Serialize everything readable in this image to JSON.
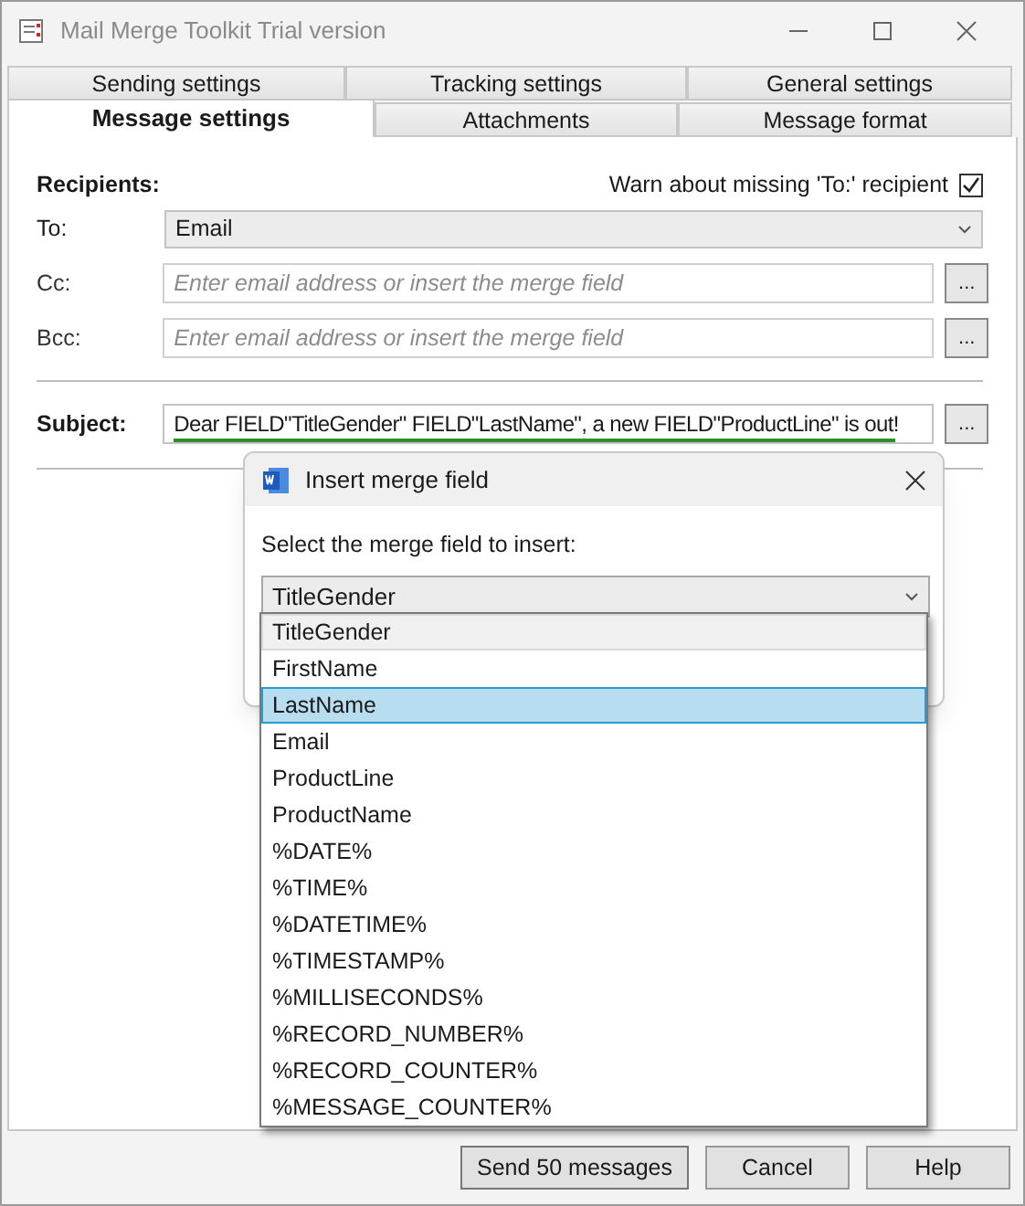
{
  "window": {
    "title": "Mail Merge Toolkit Trial version"
  },
  "tabs": [
    [
      {
        "label": "Sending settings",
        "selected": false
      },
      {
        "label": "Tracking settings",
        "selected": false
      },
      {
        "label": "General settings",
        "selected": false
      }
    ],
    [
      {
        "label": "Message settings",
        "selected": true
      },
      {
        "label": "Attachments",
        "selected": false
      },
      {
        "label": "Message format",
        "selected": false
      }
    ]
  ],
  "recipients": {
    "label": "Recipients:",
    "warn_label": "Warn about missing 'To:' recipient",
    "warn_checked": true,
    "to": {
      "label": "To:",
      "value": "Email"
    },
    "cc": {
      "label": "Cc:",
      "placeholder": "Enter email address or insert the merge field",
      "button": "..."
    },
    "bcc": {
      "label": "Bcc:",
      "placeholder": "Enter email address or insert the merge field",
      "button": "..."
    }
  },
  "subject": {
    "label": "Subject:",
    "value": "Dear FIELD\"TitleGender\" FIELD\"LastName\", a new FIELD\"ProductLine\" is out!",
    "underlined": true,
    "button": "..."
  },
  "dialog": {
    "title": "Insert merge field",
    "prompt": "Select the merge field to insert:",
    "value": "TitleGender",
    "options": [
      {
        "label": "TitleGender",
        "selected": true,
        "highlighted": false
      },
      {
        "label": "FirstName",
        "selected": false,
        "highlighted": false
      },
      {
        "label": "LastName",
        "selected": false,
        "highlighted": true
      },
      {
        "label": "Email",
        "selected": false,
        "highlighted": false
      },
      {
        "label": "ProductLine",
        "selected": false,
        "highlighted": false
      },
      {
        "label": "ProductName",
        "selected": false,
        "highlighted": false
      },
      {
        "label": "%DATE%",
        "selected": false,
        "highlighted": false
      },
      {
        "label": "%TIME%",
        "selected": false,
        "highlighted": false
      },
      {
        "label": "%DATETIME%",
        "selected": false,
        "highlighted": false
      },
      {
        "label": "%TIMESTAMP%",
        "selected": false,
        "highlighted": false
      },
      {
        "label": "%MILLISECONDS%",
        "selected": false,
        "highlighted": false
      },
      {
        "label": "%RECORD_NUMBER%",
        "selected": false,
        "highlighted": false
      },
      {
        "label": "%RECORD_COUNTER%",
        "selected": false,
        "highlighted": false
      },
      {
        "label": "%MESSAGE_COUNTER%",
        "selected": false,
        "highlighted": false
      }
    ]
  },
  "buttons": [
    "Send 50 messages",
    "Cancel",
    "Help"
  ]
}
